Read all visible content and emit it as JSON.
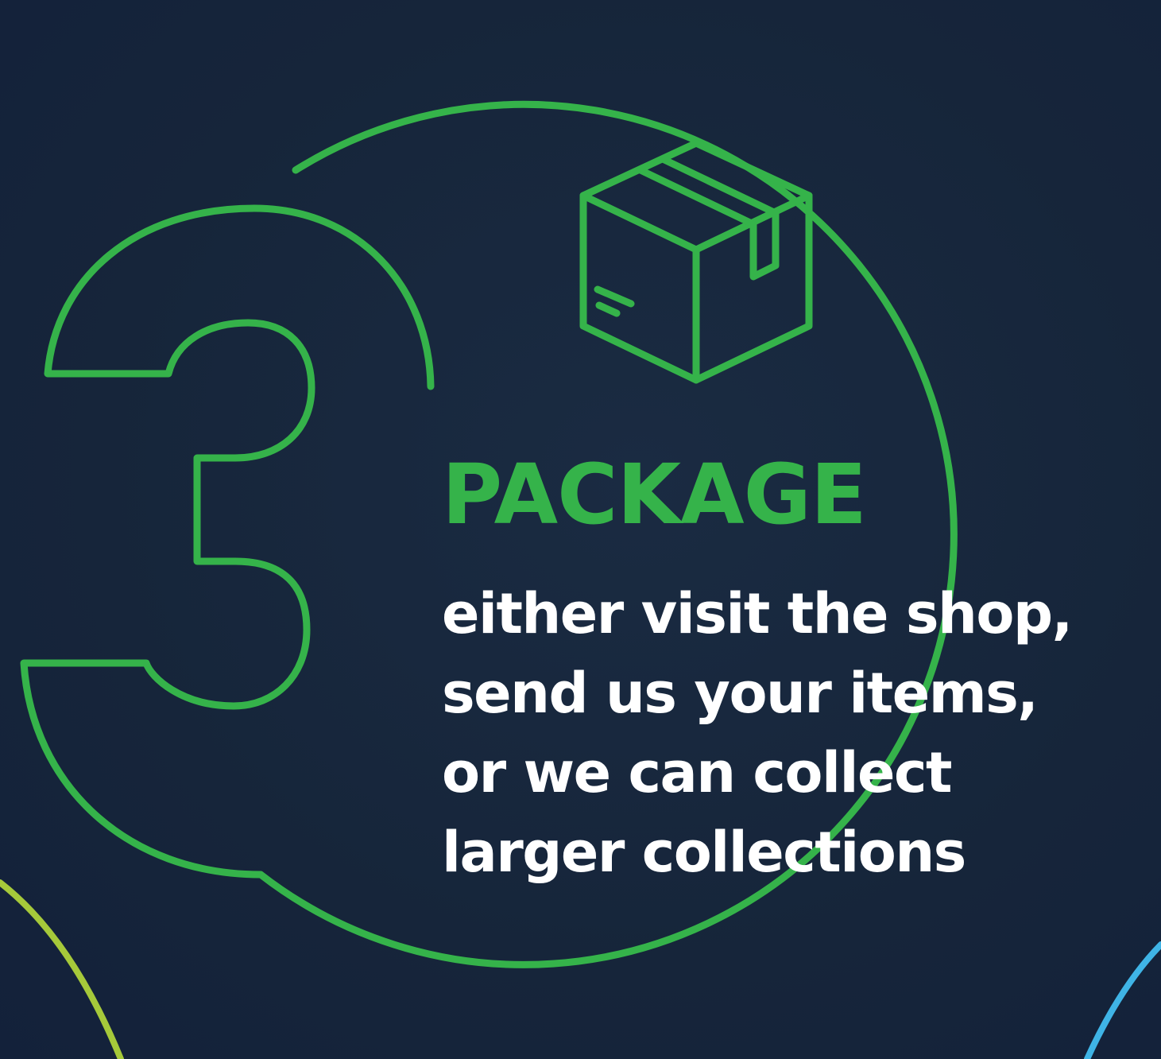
{
  "step": {
    "heading": "PACKAGE",
    "description_lines": [
      "either visit the shop,",
      "send us your items,",
      "or we can collect",
      "larger collections"
    ]
  },
  "graphics": {
    "step_number_outline": "3",
    "icon": "package-box-icon"
  },
  "colors": {
    "background": "#16253a",
    "accent_green": "#35b34a",
    "text": "#ffffff",
    "lime_curve": "#a6c93a",
    "blue_curve": "#3fb4e6"
  }
}
